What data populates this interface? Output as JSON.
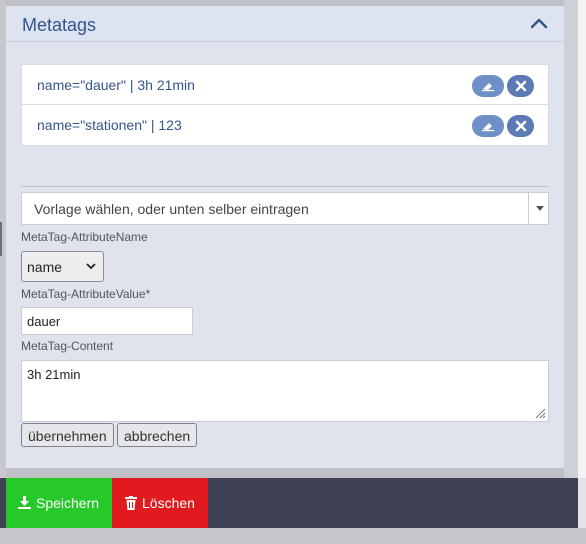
{
  "panel": {
    "title": "Metatags"
  },
  "metatags": [
    {
      "text": "name=\"dauer\" | 3h 21min"
    },
    {
      "text": "name=\"stationen\" | 123"
    }
  ],
  "template_select": {
    "placeholder": "Vorlage wählen, oder unten selber eintragen"
  },
  "form": {
    "attr_name_label": "MetaTag-AttributeName",
    "attr_name_value": "name",
    "attr_value_label": "MetaTag-AttributeValue*",
    "attr_value_value": "dauer",
    "content_label": "MetaTag-Content",
    "content_value": "3h 21min",
    "apply_label": "übernehmen",
    "cancel_label": "abbrechen"
  },
  "footer": {
    "save_label": "Speichern",
    "delete_label": "Löschen"
  },
  "colors": {
    "accent": "#34558b",
    "save": "#27c92a",
    "delete": "#e11a1f"
  },
  "icons": [
    "chevron-up-icon",
    "eraser-icon",
    "close-icon",
    "download-icon",
    "trash-icon",
    "resize-grip-icon"
  ]
}
